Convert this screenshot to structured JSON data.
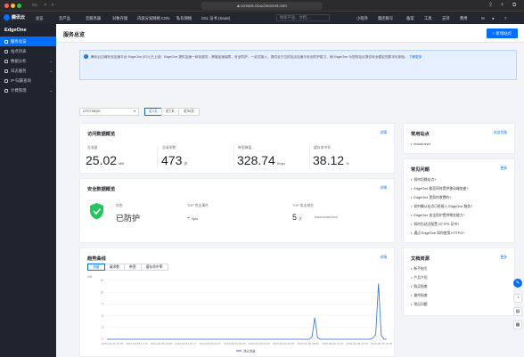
{
  "browser": {
    "url": "console.cloud.tencent.com"
  },
  "topnav": {
    "logo": "腾讯云",
    "items": [
      "总览",
      "云产品",
      "云服务器",
      "对象存储",
      "内容分发网络 CDN",
      "私有网络",
      "SSL 证书 (SaaS)"
    ],
    "search_placeholder": "搜索产品、文档...",
    "right_items": [
      "小程序",
      "集团账号",
      "备案",
      "工具",
      "支持",
      "费用"
    ]
  },
  "sidebar": {
    "brand": "EdgeOne",
    "items": [
      {
        "label": "服务总览",
        "active": true
      },
      {
        "label": "站点列表",
        "active": false
      },
      {
        "label": "数据分析",
        "active": false
      },
      {
        "label": "日志服务",
        "active": false
      },
      {
        "label": "IP 归属查询",
        "active": false
      },
      {
        "label": "计费管理",
        "active": false
      }
    ]
  },
  "header": {
    "title": "服务总览",
    "primary_button": "+ 新增站点"
  },
  "notice": {
    "text": "腾讯云边缘安全加速平台 EdgeOne (EO) 已上线！EdgeOne 提供加速一体化服务，跨境加速保障，安全防护，一站式接入，提供全方位的站点加速与安全防护能力，使 EdgeOne 为您的站点提供安全稳定的数字化体验。",
    "link": "了解更多"
  },
  "toolbar": {
    "timezone": "UTC+08:00",
    "ranges": [
      {
        "label": "近1天",
        "active": true
      },
      {
        "label": "近7天",
        "active": false
      },
      {
        "label": "近30天",
        "active": false
      }
    ]
  },
  "traffic": {
    "title": "访问数据概览",
    "link": "详情",
    "metrics": [
      {
        "label": "总流量",
        "value": "25.02",
        "unit": "MB"
      },
      {
        "label": "总请求数",
        "value": "473",
        "unit": "次"
      },
      {
        "label": "带宽峰值",
        "value": "328.74",
        "unit": "Kbps"
      },
      {
        "label": "缓存命中率",
        "value": "38.12",
        "unit": "%"
      }
    ]
  },
  "security": {
    "title": "安全数据概览",
    "link": "详情",
    "status_label": "状态",
    "status_value": "已防护",
    "top_label": "TOP 攻击事件",
    "top_value": "-",
    "top_unit": "5pts",
    "domain_label": "TOP 攻击域名",
    "domain_value": "5",
    "domain_unit": "次",
    "domain_name": "www.enock.tech"
  },
  "trend": {
    "title": "趋势曲线",
    "link": "详情",
    "tabs": [
      {
        "label": "流量",
        "active": true
      },
      {
        "label": "请求数",
        "active": false
      },
      {
        "label": "带宽",
        "active": false
      },
      {
        "label": "缓存命中率",
        "active": false
      }
    ]
  },
  "chart_data": {
    "type": "line",
    "xlabel": "",
    "ylabel": "",
    "unit_label": "MB",
    "ylim": [
      0,
      15
    ],
    "yticks": [
      0,
      3,
      6,
      9,
      12,
      15
    ],
    "x_tick_labels": [
      "2023-06-05 15:35",
      "2023-06-05 17:45",
      "2023-06-05 20:08",
      "2023-06-05 22:17",
      "2023-06-06 00:27",
      "2023-06-06 02:35",
      "2023-06-06 04:45",
      "2023-06-06 06:55",
      "2023-06-06 09:05",
      "2023-06-06 11:15",
      "2023-06-06 13:25",
      "2023-06-06 15:35"
    ],
    "series": [
      {
        "name": "流出流量",
        "color": "#2f6fe4",
        "values": [
          0,
          0,
          0,
          0,
          0,
          0,
          0,
          0,
          0,
          0,
          0,
          0,
          0,
          0,
          0,
          0,
          0,
          0,
          0,
          0,
          0,
          0,
          0,
          0,
          0,
          0,
          0,
          0,
          0,
          0,
          0,
          0,
          0,
          0,
          0,
          0,
          0,
          0,
          0,
          0,
          0,
          0,
          0,
          0,
          0,
          0,
          0,
          0,
          0,
          0,
          0,
          0,
          0,
          0,
          0,
          0,
          0,
          0,
          0,
          0,
          0,
          0,
          0,
          0,
          0,
          0,
          0,
          0,
          0,
          0,
          0,
          0,
          0,
          0,
          0.6,
          5.5,
          0.4,
          0,
          0,
          0,
          0,
          0,
          0,
          0,
          0,
          0,
          0,
          0,
          0,
          0,
          0,
          0,
          0,
          0,
          0,
          0,
          0.3,
          1.2,
          14.2,
          1.0,
          0,
          0
        ]
      }
    ]
  },
  "sites": {
    "title": "常用站点",
    "link": "站点列表",
    "items": [
      "enock.tech"
    ]
  },
  "faq": {
    "title": "常见问题",
    "link": "更多",
    "items": [
      "如何切换站点?",
      "EdgeOne 能否同时提供移动端加速?",
      "EdgeOne 是如何收费的?",
      "如何确认站点已经接入 EdgeOne 服务?",
      "EdgeOne 安全防护提供哪些能力?",
      "如何为站点配置 HTTPS 证书?",
      "通过 EdgeOne 如何使用 HTTP/3?"
    ]
  },
  "docs": {
    "title": "文档资源",
    "link": "更多",
    "items": [
      "新手指引",
      "产品介绍",
      "购买指南",
      "操作指南",
      "常见问题"
    ]
  },
  "float_buttons": [
    "edit-icon",
    "chat-icon",
    "book-icon",
    "grid-icon"
  ],
  "colors": {
    "brand": "#006eff",
    "sidebar_bg": "#20242e",
    "line": "#2f6fe4",
    "shield": "#22c55e"
  }
}
